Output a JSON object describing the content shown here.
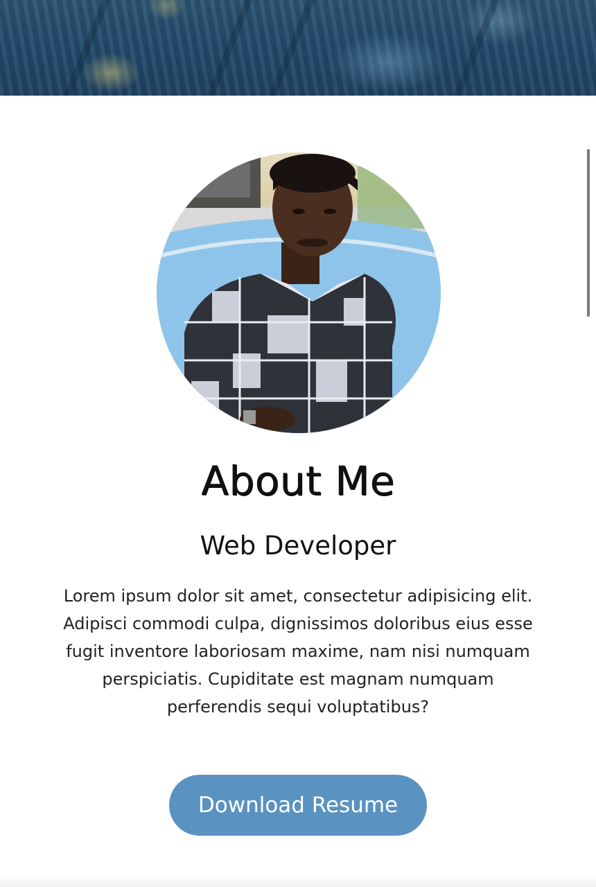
{
  "banner": {
    "image": "blurred-blue-abstract-background"
  },
  "profile": {
    "photo": "profile-photo-portrait"
  },
  "about": {
    "title": "About Me",
    "subtitle": "Web Developer",
    "bio": "Lorem ipsum dolor sit amet, consectetur adipisicing elit. Adipisci commodi culpa, dignissimos doloribus eius esse fugit inventore laboriosam maxime, nam nisi numquam perspiciatis. Cupiditate est magnam numquam perferendis sequi voluptatibus?"
  },
  "cta": {
    "download_label": "Download Resume"
  },
  "colors": {
    "button": "#5a92c1",
    "banner": "#234a6b",
    "text": "#111111"
  }
}
